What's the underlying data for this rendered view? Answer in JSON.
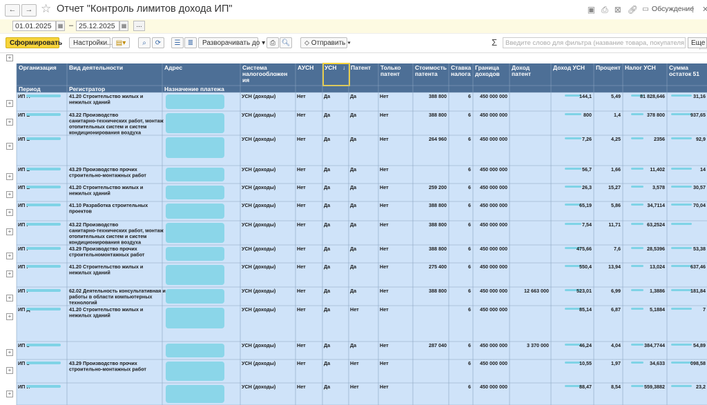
{
  "window": {
    "title": "Отчет \"Контроль лимитов дохода ИП\"",
    "back_label": "←",
    "forward_label": "→",
    "discuss_label": "Обсуждение"
  },
  "period": {
    "from": "01.01.2025",
    "dash": "–",
    "to": "25.12.2025",
    "dots_label": "..."
  },
  "toolbar": {
    "generate_label": "Сформировать",
    "settings_label": "Настройки...",
    "expand_label": "Разворачивать до",
    "send_label": "Отправить",
    "search_placeholder": "Введите слово для фильтра (название товара, покупателя и пр.)",
    "more_label": "Еще"
  },
  "colors": {
    "header_bg": "#4d6f96",
    "row_bg": "#cfe3f9",
    "grid_line": "#8aa3c0",
    "accent": "#f7d43a",
    "blur": "#7fd3e6"
  },
  "table": {
    "columns": [
      {
        "title": [
          "Организация"
        ],
        "sub": "Период"
      },
      {
        "title": [
          "Вид деятельности"
        ],
        "sub": "Регистратор"
      },
      {
        "title": [
          "Адрес"
        ],
        "sub": "Назначение платежа"
      },
      {
        "title": [
          "Система",
          "налогообложен",
          "ия"
        ],
        "sub": ""
      },
      {
        "title": [
          "АУСН"
        ],
        "sub": ""
      },
      {
        "title": [
          "УСН"
        ],
        "sub": ""
      },
      {
        "title": [
          "Патент"
        ],
        "sub": ""
      },
      {
        "title": [
          "Только",
          "патент"
        ],
        "sub": ""
      },
      {
        "title": [
          "Стоимость",
          "патента"
        ],
        "sub": ""
      },
      {
        "title": [
          "Ставка",
          "налога"
        ],
        "sub": ""
      },
      {
        "title": [
          "Граница",
          "доходов"
        ],
        "sub": ""
      },
      {
        "title": [
          "Доход",
          "патент"
        ],
        "sub": ""
      },
      {
        "title": [
          "Доход УСН"
        ],
        "sub": ""
      },
      {
        "title": [
          "Процент"
        ],
        "sub": ""
      },
      {
        "title": [
          "Налог УСН"
        ],
        "sub": ""
      },
      {
        "title": [
          "Сумма",
          "остаток 51"
        ],
        "sub": ""
      }
    ],
    "rows": [
      {
        "org": "ИП А",
        "activity": [
          "41.20 Строительство жилых и",
          "нежилых зданий"
        ],
        "tax": "УСН (доходы)",
        "ausn": "Нет",
        "usn": "Да",
        "patent": "Да",
        "only_patent": "Нет",
        "patent_cost": "388 800",
        "rate": "6",
        "limit": "450 000 000",
        "income_patent": "",
        "income_usn": "144,1",
        "percent": "5,49",
        "tax_usn": "81 828,646",
        "balance": "31,16"
      },
      {
        "org": "ИП Б",
        "activity": [
          "43.22 Производство",
          "санитарно-технических работ, монтаж",
          "отопительных систем и систем",
          "кондиционирования воздуха"
        ],
        "tax": "УСН (доходы)",
        "ausn": "Нет",
        "usn": "Да",
        "patent": "Да",
        "only_patent": "Нет",
        "patent_cost": "388 800",
        "rate": "6",
        "limit": "450 000 000",
        "income_patent": "",
        "income_usn": "800",
        "percent": "1,4",
        "tax_usn": "378 800",
        "balance": "937,65"
      },
      {
        "org": "ИП Б",
        "activity": [],
        "tax": "УСН (доходы)",
        "ausn": "Нет",
        "usn": "Да",
        "patent": "Да",
        "only_patent": "Нет",
        "patent_cost": "264 960",
        "rate": "6",
        "limit": "450 000 000",
        "income_patent": "",
        "income_usn": "7,26",
        "percent": "4,25",
        "tax_usn": "2356",
        "balance": "92,9"
      },
      {
        "org": "ИП Б",
        "activity": [
          "43.29 Производство прочих",
          "строительно-монтажных работ"
        ],
        "tax": "УСН (доходы)",
        "ausn": "Нет",
        "usn": "Да",
        "patent": "Да",
        "only_patent": "Нет",
        "patent_cost": "",
        "rate": "6",
        "limit": "450 000 000",
        "income_patent": "",
        "income_usn": "56,7",
        "percent": "1,66",
        "tax_usn": "11,402",
        "balance": "14"
      },
      {
        "org": "ИП В",
        "activity": [
          "41.20 Строительство жилых и",
          "нежилых зданий"
        ],
        "tax": "УСН (доходы)",
        "ausn": "Нет",
        "usn": "Да",
        "patent": "Да",
        "only_patent": "Нет",
        "patent_cost": "259 200",
        "rate": "6",
        "limit": "450 000 000",
        "income_patent": "",
        "income_usn": "26,3",
        "percent": "15,27",
        "tax_usn": "3,578",
        "balance": "30,57"
      },
      {
        "org": "ИП Г",
        "activity": [
          "41.10 Разработка строительных",
          "проектов"
        ],
        "tax": "УСН (доходы)",
        "ausn": "Нет",
        "usn": "Да",
        "patent": "Да",
        "only_patent": "Нет",
        "patent_cost": "388 800",
        "rate": "6",
        "limit": "450 000 000",
        "income_patent": "",
        "income_usn": "65,19",
        "percent": "5,86",
        "tax_usn": "34,7114",
        "balance": "70,04"
      },
      {
        "org": "ИП Г",
        "activity": [
          "43.22 Производство",
          "санитарно-технических работ, монтаж",
          "отопительных систем и систем",
          "кондиционирования воздуха"
        ],
        "tax": "УСН (доходы)",
        "ausn": "Нет",
        "usn": "Да",
        "patent": "Да",
        "only_patent": "Нет",
        "patent_cost": "388 800",
        "rate": "6",
        "limit": "450 000 000",
        "income_patent": "",
        "income_usn": "7,54",
        "percent": "11,71",
        "tax_usn": "63,2524",
        "balance": ""
      },
      {
        "org": "ИП Г",
        "activity": [
          "43.29 Производство прочих",
          "строительномонтажных работ"
        ],
        "tax": "УСН (доходы)",
        "ausn": "Нет",
        "usn": "Да",
        "patent": "Да",
        "only_patent": "Нет",
        "patent_cost": "388 800",
        "rate": "6",
        "limit": "450 000 000",
        "income_patent": "",
        "income_usn": "475,66",
        "percent": "7,6",
        "tax_usn": "28,5396",
        "balance": "53,38"
      },
      {
        "org": "ИП Г",
        "activity": [
          "41.20 Строительство жилых и",
          "нежилых зданий"
        ],
        "tax": "УСН (доходы)",
        "ausn": "Нет",
        "usn": "Да",
        "patent": "Да",
        "only_patent": "Нет",
        "patent_cost": "275 400",
        "rate": "6",
        "limit": "450 000 000",
        "income_patent": "",
        "income_usn": "550,4",
        "percent": "13,94",
        "tax_usn": "13,024",
        "balance": "637,46"
      },
      {
        "org": "ИП Г",
        "activity": [
          "62.02 Деятельность консультативная и",
          "работы в области компьютерных",
          "технологий"
        ],
        "tax": "УСН (доходы)",
        "ausn": "Нет",
        "usn": "Да",
        "patent": "Да",
        "only_patent": "Нет",
        "patent_cost": "388 800",
        "rate": "6",
        "limit": "450 000 000",
        "income_patent": "12 663 000",
        "income_usn": "523,01",
        "percent": "6,99",
        "tax_usn": "1,3886",
        "balance": "181,84"
      },
      {
        "org": "ИП Д",
        "activity": [
          "41.20 Строительство жилых и",
          "нежилых зданий"
        ],
        "tax": "УСН (доходы)",
        "ausn": "Нет",
        "usn": "Да",
        "patent": "Нет",
        "only_patent": "Нет",
        "patent_cost": "",
        "rate": "6",
        "limit": "450 000 000",
        "income_patent": "",
        "income_usn": "85,14",
        "percent": "6,87",
        "tax_usn": "5,1884",
        "balance": "7"
      },
      {
        "org": "ИП З",
        "activity": [],
        "tax": "УСН (доходы)",
        "ausn": "Нет",
        "usn": "Да",
        "patent": "Да",
        "only_patent": "Нет",
        "patent_cost": "287 040",
        "rate": "6",
        "limit": "450 000 000",
        "income_patent": "3 370 000",
        "income_usn": "46,24",
        "percent": "4,04",
        "tax_usn": "384,7744",
        "balance": "54,89"
      },
      {
        "org": "ИП З",
        "activity": [
          "43.29 Производство прочих",
          "строительно-монтажных работ"
        ],
        "tax": "УСН (доходы)",
        "ausn": "Нет",
        "usn": "Да",
        "patent": "Нет",
        "only_patent": "Нет",
        "patent_cost": "",
        "rate": "6",
        "limit": "450 000 000",
        "income_patent": "",
        "income_usn": "10,55",
        "percent": "1,97",
        "tax_usn": "34,633",
        "balance": "098,58"
      },
      {
        "org": "ИП И",
        "activity": [],
        "tax": "УСН (доходы)",
        "ausn": "Нет",
        "usn": "Да",
        "patent": "Нет",
        "only_patent": "Нет",
        "patent_cost": "",
        "rate": "6",
        "limit": "450 000 000",
        "income_patent": "",
        "income_usn": "88,47",
        "percent": "8,54",
        "tax_usn": "559,3882",
        "balance": "23,2"
      }
    ]
  }
}
